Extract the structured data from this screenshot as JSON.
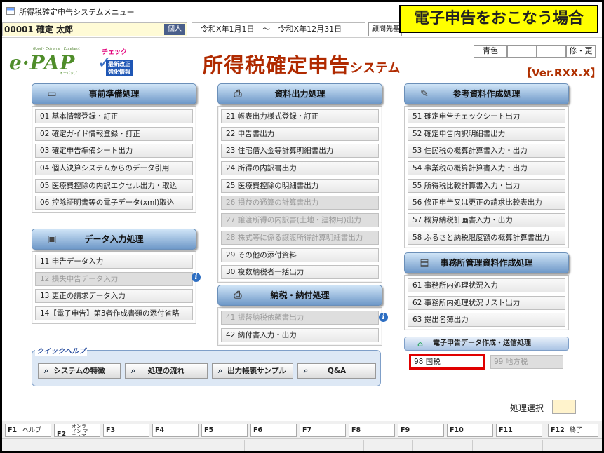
{
  "window": {
    "title": "所得税確定申告システムメニュー"
  },
  "callout": "電子申告をおこなう場合",
  "info": {
    "client": "00001 確定 太郎",
    "client_type": "個人",
    "period_from": "令和X年1月1日",
    "period_sep": "～",
    "period_to": "令和X年12月31日",
    "komon": "顧問先基本"
  },
  "color_buttons": [
    "青色",
    "",
    "",
    "修・更"
  ],
  "version": "【Ver.RXX.X】",
  "logo": {
    "tag": "Good · Extreme · Excellent",
    "main": "e·PAP",
    "sub": "イーパップ",
    "check_label": "チェック",
    "check_box": [
      "最新改正",
      "強化情報"
    ]
  },
  "system_title": {
    "main": "所得税確定申告",
    "suffix": "システム"
  },
  "panels": {
    "jizen": {
      "title": "事前準備処理",
      "items": [
        "01 基本情報登録・訂正",
        "02 確定ガイド情報登録・訂正",
        "03 確定申告準備シート出力",
        "04 個人決算システムからのデータ引用",
        "05 医療費控除の内訳エクセル出力・取込",
        "06 控除証明書等の電子データ(xml)取込"
      ]
    },
    "data_input": {
      "title": "データ入力処理",
      "items": [
        "11 申告データ入力",
        "12 損失申告データ入力",
        "13 更正の請求データ入力",
        "14【電子申告】第3者作成書類の添付省略"
      ]
    },
    "shiryo": {
      "title": "資料出力処理",
      "items": [
        "21 帳表出力様式登録・訂正",
        "22 申告書出力",
        "23 住宅借入金等計算明細書出力",
        "24 所得の内訳書出力",
        "25 医療費控除の明細書出力",
        "26 損益の通算の計算書出力",
        "27 譲渡所得の内訳書(土地・建物用)出力",
        "28 株式等に係る譲渡所得計算明細書出力",
        "29 その他の添付資料",
        "30 複数納税者一括出力"
      ]
    },
    "nozei": {
      "title": "納税・納付処理",
      "items": [
        "41 振替納税依頼書出力",
        "42 納付書入力・出力"
      ]
    },
    "sanko": {
      "title": "参考資料作成処理",
      "items": [
        "51 確定申告チェックシート出力",
        "52 確定申告内訳明細書出力",
        "53 住民税の概算計算書入力・出力",
        "54 事業税の概算計算書入力・出力",
        "55 所得税比較計算書入力・出力",
        "56 修正申告又は更正の請求比較表出力",
        "57 概算納税計画書入力・出力",
        "58 ふるさと納税限度額の概算計算書出力"
      ]
    },
    "jimusho": {
      "title": "事務所管理資料作成処理",
      "items": [
        "61 事務所内処理状況入力",
        "62 事務所内処理状況リスト出力",
        "63 提出名簿出力"
      ]
    },
    "denshi": {
      "title": "電子申告データ作成・送信処理",
      "kokuzei": "98 国税",
      "chiho": "99 地方税"
    }
  },
  "quick_help": {
    "title": "クイックヘルプ",
    "buttons": [
      "システムの特徴",
      "処理の流れ",
      "出力帳表サンプル",
      "Q&A"
    ]
  },
  "select_label": "処理選択",
  "fkeys": [
    {
      "key": "F1",
      "label": "ヘルプ"
    },
    {
      "key": "F2",
      "label": "オンライン マニュアル"
    },
    {
      "key": "F3",
      "label": ""
    },
    {
      "key": "F4",
      "label": ""
    },
    {
      "key": "F5",
      "label": ""
    },
    {
      "key": "F6",
      "label": ""
    },
    {
      "key": "F7",
      "label": ""
    },
    {
      "key": "F8",
      "label": ""
    },
    {
      "key": "F9",
      "label": ""
    },
    {
      "key": "F10",
      "label": ""
    },
    {
      "key": "F11",
      "label": ""
    },
    {
      "key": "F12",
      "label": "終了"
    }
  ]
}
